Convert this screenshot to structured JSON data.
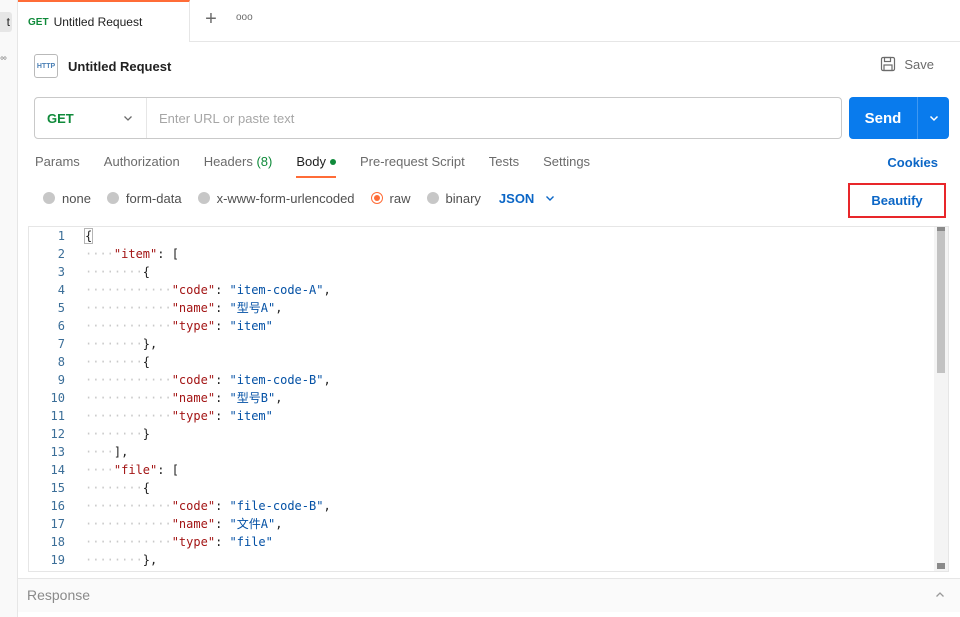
{
  "sidebar": {
    "chip_text": "t",
    "more_glyph": "°°"
  },
  "tabs": [
    {
      "method": "GET",
      "title": "Untitled Request"
    }
  ],
  "tabbar": {
    "add_glyph": "+",
    "more_glyph": "ooo"
  },
  "request": {
    "icon_text": "HTTP",
    "title": "Untitled Request",
    "save_label": "Save",
    "method": "GET",
    "url_value": "",
    "url_placeholder": "Enter URL or paste text",
    "send_label": "Send"
  },
  "request_tabs": [
    {
      "label": "Params"
    },
    {
      "label": "Authorization"
    },
    {
      "label": "Headers ",
      "count": "(8)"
    },
    {
      "label": "Body",
      "active": true,
      "dot": true
    },
    {
      "label": "Pre-request Script"
    },
    {
      "label": "Tests"
    },
    {
      "label": "Settings"
    }
  ],
  "cookies_label": "Cookies",
  "body_types": [
    {
      "label": "none",
      "selected": false
    },
    {
      "label": "form-data",
      "selected": false
    },
    {
      "label": "x-www-form-urlencoded",
      "selected": false
    },
    {
      "label": "raw",
      "selected": true
    },
    {
      "label": "binary",
      "selected": false
    }
  ],
  "raw_language": "JSON",
  "beautify_label": "Beautify",
  "editor": {
    "lines": [
      [
        [
          "0",
          ""
        ],
        [
          "p",
          "{"
        ]
      ],
      [
        [
          "4",
          ""
        ],
        [
          "k",
          "\"item\""
        ],
        [
          "p",
          ": ["
        ]
      ],
      [
        [
          "8",
          ""
        ],
        [
          "p",
          "{"
        ]
      ],
      [
        [
          "12",
          ""
        ],
        [
          "k",
          "\"code\""
        ],
        [
          "p",
          ": "
        ],
        [
          "s",
          "\"item-code-A\""
        ],
        [
          "p",
          ","
        ]
      ],
      [
        [
          "12",
          ""
        ],
        [
          "k",
          "\"name\""
        ],
        [
          "p",
          ": "
        ],
        [
          "s",
          "\"型号A\""
        ],
        [
          "p",
          ","
        ]
      ],
      [
        [
          "12",
          ""
        ],
        [
          "k",
          "\"type\""
        ],
        [
          "p",
          ": "
        ],
        [
          "s",
          "\"item\""
        ]
      ],
      [
        [
          "8",
          ""
        ],
        [
          "p",
          "},"
        ]
      ],
      [
        [
          "8",
          ""
        ],
        [
          "p",
          "{"
        ]
      ],
      [
        [
          "12",
          ""
        ],
        [
          "k",
          "\"code\""
        ],
        [
          "p",
          ": "
        ],
        [
          "s",
          "\"item-code-B\""
        ],
        [
          "p",
          ","
        ]
      ],
      [
        [
          "12",
          ""
        ],
        [
          "k",
          "\"name\""
        ],
        [
          "p",
          ": "
        ],
        [
          "s",
          "\"型号B\""
        ],
        [
          "p",
          ","
        ]
      ],
      [
        [
          "12",
          ""
        ],
        [
          "k",
          "\"type\""
        ],
        [
          "p",
          ": "
        ],
        [
          "s",
          "\"item\""
        ]
      ],
      [
        [
          "8",
          ""
        ],
        [
          "p",
          "}"
        ]
      ],
      [
        [
          "4",
          ""
        ],
        [
          "p",
          "],"
        ]
      ],
      [
        [
          "4",
          ""
        ],
        [
          "k",
          "\"file\""
        ],
        [
          "p",
          ": ["
        ]
      ],
      [
        [
          "8",
          ""
        ],
        [
          "p",
          "{"
        ]
      ],
      [
        [
          "12",
          ""
        ],
        [
          "k",
          "\"code\""
        ],
        [
          "p",
          ": "
        ],
        [
          "s",
          "\"file-code-B\""
        ],
        [
          "p",
          ","
        ]
      ],
      [
        [
          "12",
          ""
        ],
        [
          "k",
          "\"name\""
        ],
        [
          "p",
          ": "
        ],
        [
          "s",
          "\"文件A\""
        ],
        [
          "p",
          ","
        ]
      ],
      [
        [
          "12",
          ""
        ],
        [
          "k",
          "\"type\""
        ],
        [
          "p",
          ": "
        ],
        [
          "s",
          "\"file\""
        ]
      ],
      [
        [
          "8",
          ""
        ],
        [
          "p",
          "},"
        ]
      ]
    ],
    "line_numbers": [
      "1",
      "2",
      "3",
      "4",
      "5",
      "6",
      "7",
      "8",
      "9",
      "10",
      "11",
      "12",
      "13",
      "14",
      "15",
      "16",
      "17",
      "18",
      "19"
    ]
  },
  "response_label": "Response",
  "colors": {
    "accent_orange": "#ff6c37",
    "send_blue": "#097bed",
    "link_blue": "#0b66c6",
    "get_green": "#0f8a3a",
    "highlight_red": "#e8262a"
  }
}
